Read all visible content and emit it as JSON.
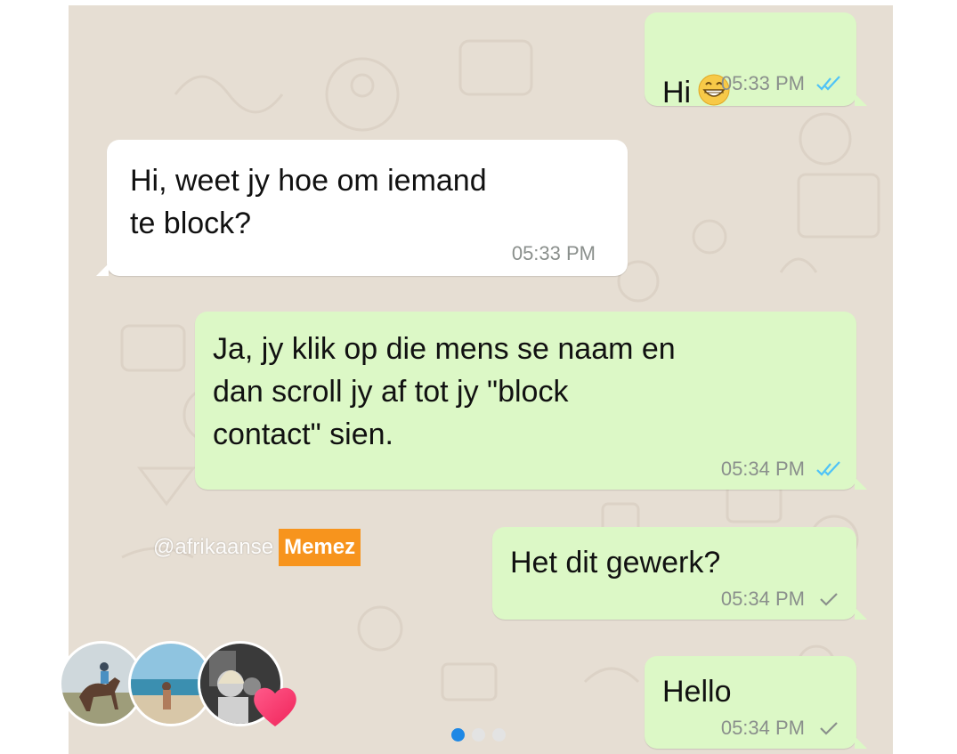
{
  "messages": [
    {
      "id": "m1",
      "direction": "out",
      "text": "Hi",
      "emoji": "grinning-face",
      "time": "05:33 PM",
      "status": "read"
    },
    {
      "id": "m2",
      "direction": "in",
      "text": "Hi, weet jy hoe om iemand\nte block?",
      "time": "05:33 PM"
    },
    {
      "id": "m3",
      "direction": "out",
      "text": "Ja, jy klik op die mens se naam en\ndan scroll jy af tot jy \"block\ncontact\" sien.",
      "time": "05:34 PM",
      "status": "read"
    },
    {
      "id": "m4",
      "direction": "out",
      "text": "Het dit gewerk?",
      "time": "05:34 PM",
      "status": "sent"
    },
    {
      "id": "m5",
      "direction": "out",
      "text": "Hello",
      "time": "05:34 PM",
      "status": "sent"
    }
  ],
  "watermark": {
    "handle": "@afrikaanse",
    "tag": "Memez"
  },
  "avatars": [
    {
      "name": "horse-rider-avatar"
    },
    {
      "name": "beach-avatar"
    },
    {
      "name": "mirror-selfie-avatar"
    }
  ],
  "reaction_icon": "heart-icon",
  "carousel": {
    "total": 3,
    "active": 0
  },
  "colors": {
    "chat_background": "#e6ded3",
    "outgoing_bubble": "#dcf8c6",
    "incoming_bubble": "#ffffff",
    "read_tick": "#4fc3f7",
    "sent_tick": "#8a8f8c",
    "memez_tag": "#f7941d",
    "active_dot": "#1e88e5"
  }
}
